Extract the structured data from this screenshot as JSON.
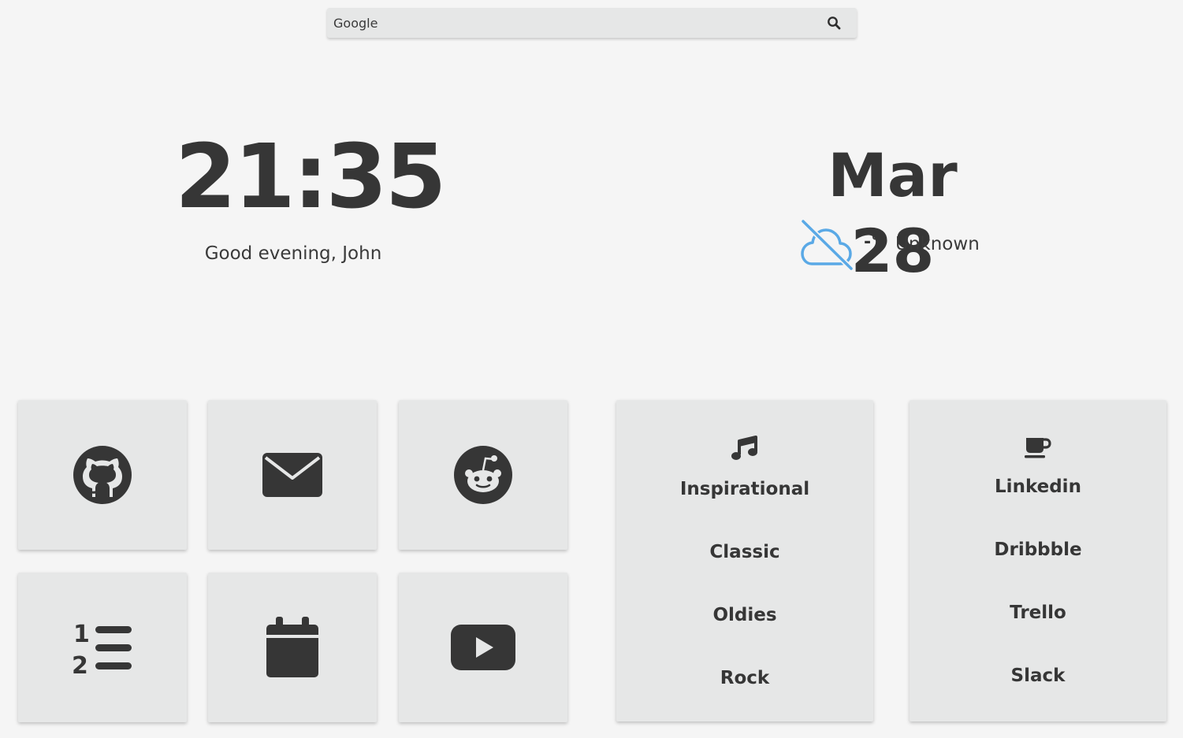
{
  "search": {
    "placeholder": "Google",
    "icon": "search-icon"
  },
  "clock": {
    "time": "21:35",
    "greeting": "Good evening, John"
  },
  "date": {
    "text": "Mar 28"
  },
  "weather": {
    "icon": "cloud-off-icon",
    "icon_color": "#5aa9e6",
    "temperature": "-°",
    "condition": "Unknown"
  },
  "tiles": [
    {
      "icon": "github-icon"
    },
    {
      "icon": "mail-icon"
    },
    {
      "icon": "reddit-icon"
    },
    {
      "icon": "ordered-list-icon"
    },
    {
      "icon": "calendar-icon"
    },
    {
      "icon": "youtube-icon"
    }
  ],
  "music_card": {
    "icon": "music-note-icon",
    "links": [
      "Inspirational",
      "Classic",
      "Oldies",
      "Rock"
    ]
  },
  "work_card": {
    "icon": "coffee-mug-icon",
    "links": [
      "Linkedin",
      "Dribbble",
      "Trello",
      "Slack"
    ]
  },
  "colors": {
    "background": "#f5f5f5",
    "card": "#e6e7e7",
    "text": "#363636"
  }
}
